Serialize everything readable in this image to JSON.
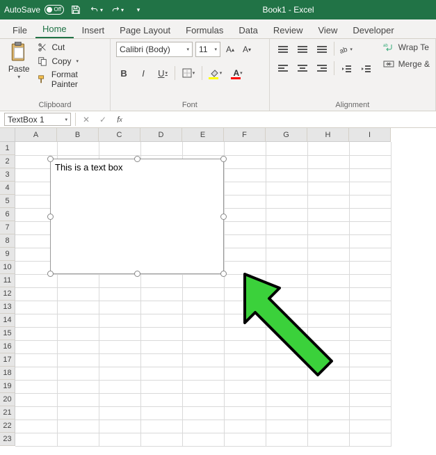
{
  "titlebar": {
    "autosave_label": "AutoSave",
    "autosave_state": "Off",
    "title": "Book1  -  Excel"
  },
  "tabs": [
    "File",
    "Home",
    "Insert",
    "Page Layout",
    "Formulas",
    "Data",
    "Review",
    "View",
    "Developer"
  ],
  "active_tab": "Home",
  "ribbon": {
    "clipboard": {
      "paste": "Paste",
      "cut": "Cut",
      "copy": "Copy",
      "format_painter": "Format Painter",
      "group_label": "Clipboard"
    },
    "font": {
      "name": "Calibri (Body)",
      "size": "11",
      "group_label": "Font"
    },
    "alignment": {
      "wrap": "Wrap Te",
      "merge": "Merge &",
      "group_label": "Alignment"
    }
  },
  "namebox": "TextBox 1",
  "columns": [
    "A",
    "B",
    "C",
    "D",
    "E",
    "F",
    "G",
    "H",
    "I"
  ],
  "rows": [
    "1",
    "2",
    "3",
    "4",
    "5",
    "6",
    "7",
    "8",
    "9",
    "10",
    "11",
    "12",
    "13",
    "14",
    "15",
    "16",
    "17",
    "18",
    "19",
    "20",
    "21",
    "22",
    "23"
  ],
  "textbox_content": "This is a text box"
}
